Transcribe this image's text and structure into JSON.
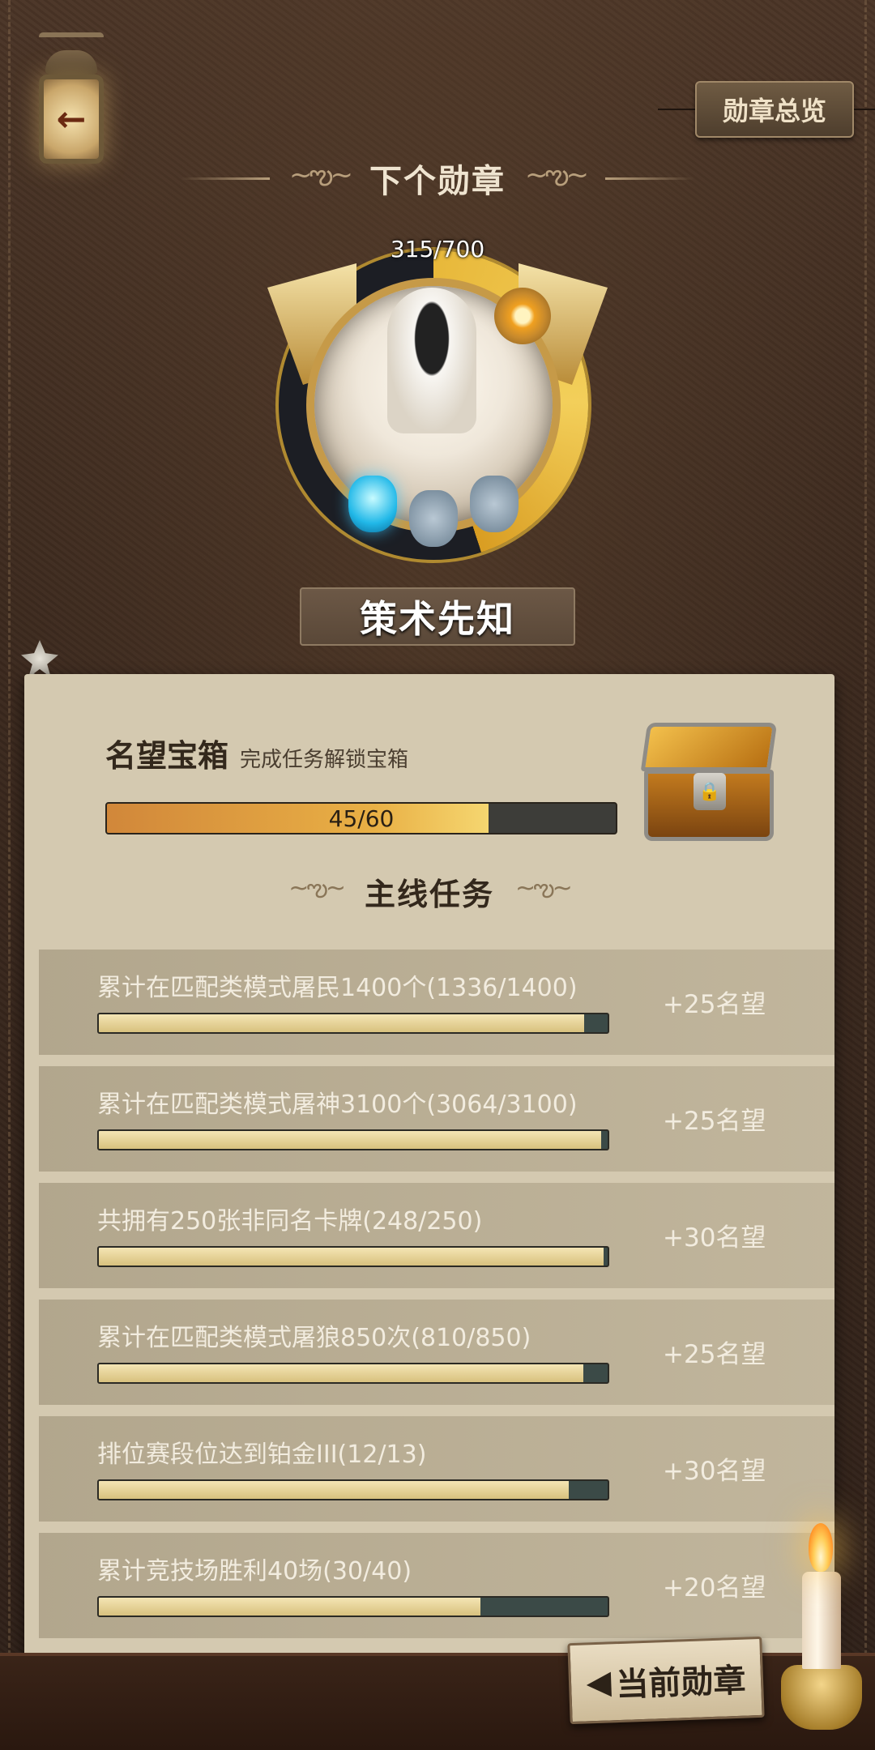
{
  "header": {
    "back_icon": "back-arrow-lantern-icon",
    "overview_label": "勋章总览",
    "next_medal_title": "下个勋章"
  },
  "medal": {
    "progress_text": "315/700",
    "progress_fraction": 0.45,
    "name": "策术先知"
  },
  "reputation_box": {
    "title": "名望宝箱",
    "subtitle": "完成任务解锁宝箱",
    "progress_text": "45/60",
    "progress_fraction": 0.75,
    "chest_icon": "treasure-chest-icon"
  },
  "main_quests": {
    "title": "主线任务",
    "tasks": [
      {
        "name": "累计在匹配类模式屠民1400个(1336/1400)",
        "progress": 0.954,
        "reward": "+25名望"
      },
      {
        "name": "累计在匹配类模式屠神3100个(3064/3100)",
        "progress": 0.988,
        "reward": "+25名望"
      },
      {
        "name": "共拥有250张非同名卡牌(248/250)",
        "progress": 0.992,
        "reward": "+30名望"
      },
      {
        "name": "累计在匹配类模式屠狼850次(810/850)",
        "progress": 0.953,
        "reward": "+25名望"
      },
      {
        "name": "排位赛段位达到铂金III(12/13)",
        "progress": 0.923,
        "reward": "+30名望"
      },
      {
        "name": "累计竞技场胜利40场(30/40)",
        "progress": 0.75,
        "reward": "+20名望"
      }
    ]
  },
  "footer": {
    "current_medal_label": "当前勋章",
    "current_medal_arrow": "◀",
    "candle_icon": "candle-icon"
  }
}
